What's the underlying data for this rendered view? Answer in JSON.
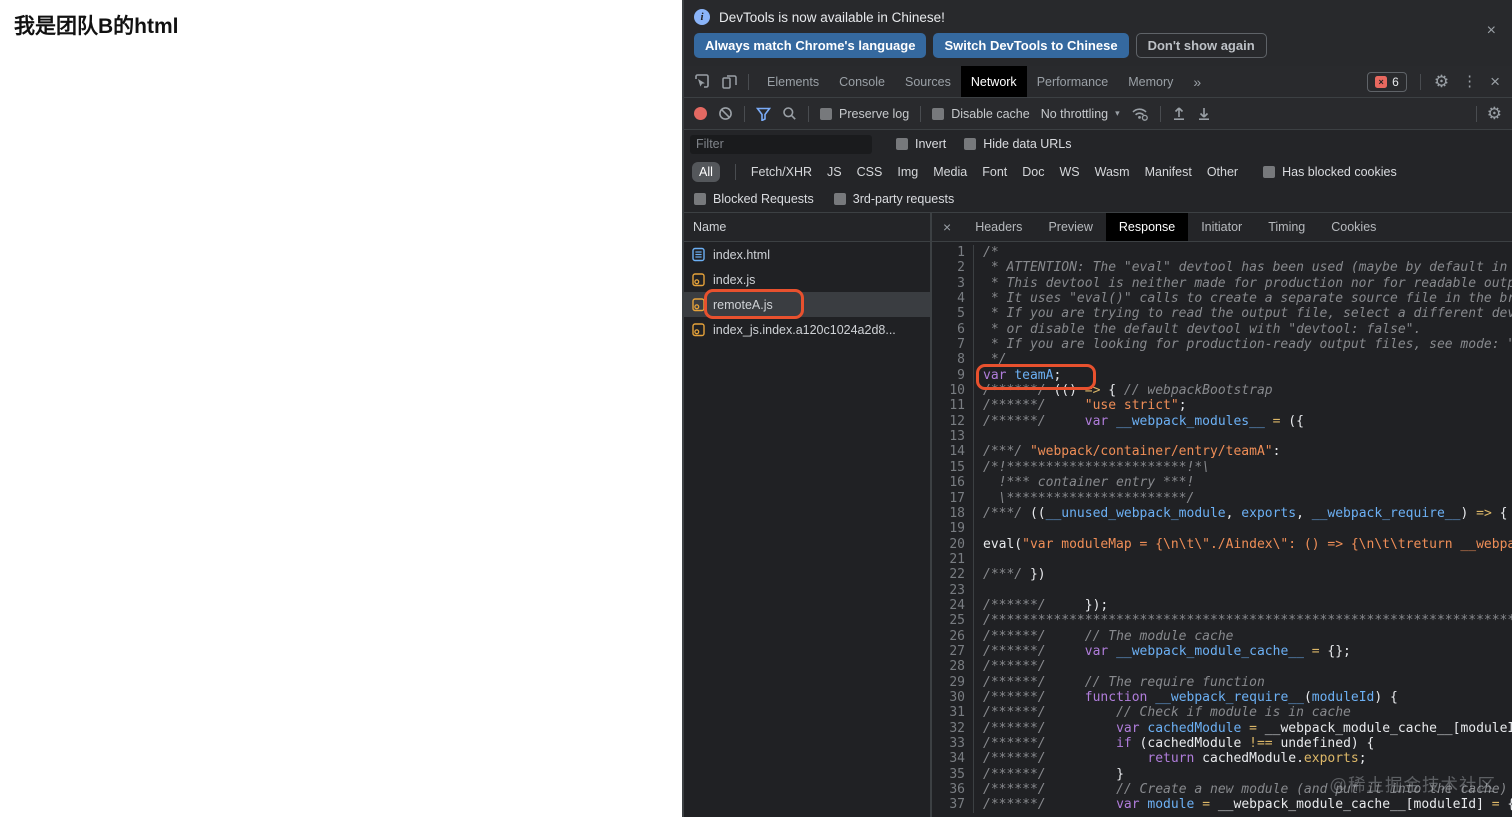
{
  "page": {
    "left_text": "我是团队B的html"
  },
  "infobar": {
    "message": "DevTools is now available in Chinese!",
    "buttons": [
      "Always match Chrome's language",
      "Switch DevTools to Chinese",
      "Don't show again"
    ],
    "close": "×"
  },
  "tabs": {
    "items": [
      "Elements",
      "Console",
      "Sources",
      "Network",
      "Performance",
      "Memory"
    ],
    "active": "Network",
    "overflow": "»",
    "error_count": "6",
    "error_x": "×",
    "gear": "⚙",
    "dots": "⋮",
    "close": "×"
  },
  "toolbar": {
    "preserve_log": "Preserve log",
    "disable_cache": "Disable cache",
    "throttling": "No throttling",
    "caret": "▾",
    "gear": "⚙"
  },
  "filterbar": {
    "placeholder": "Filter",
    "invert": "Invert",
    "hide_data_urls": "Hide data URLs"
  },
  "chips": {
    "items": [
      "All",
      "Fetch/XHR",
      "JS",
      "CSS",
      "Img",
      "Media",
      "Font",
      "Doc",
      "WS",
      "Wasm",
      "Manifest",
      "Other"
    ],
    "active": "All",
    "has_blocked_cookies": "Has blocked cookies"
  },
  "blockedrow": {
    "blocked_requests": "Blocked Requests",
    "third_party": "3rd-party requests"
  },
  "requests": {
    "header": "Name",
    "items": [
      {
        "name": "index.html",
        "icon": "doc",
        "selected": false,
        "annotated": false
      },
      {
        "name": "index.js",
        "icon": "js",
        "selected": false,
        "annotated": false
      },
      {
        "name": "remoteA.js",
        "icon": "js",
        "selected": true,
        "annotated": true
      },
      {
        "name": "index_js.index.a120c1024a2d8...",
        "icon": "js",
        "selected": false,
        "annotated": false
      }
    ]
  },
  "detail_tabs": {
    "close": "×",
    "items": [
      "Headers",
      "Preview",
      "Response",
      "Initiator",
      "Timing",
      "Cookies"
    ],
    "active": "Response"
  },
  "watermark": "@稀土掘金技术社区",
  "colors": {
    "annotation": "#e8512e",
    "accent_blue": "#8ab4f8",
    "record_red": "#e46962",
    "active_tab_bg": "#000000"
  },
  "code": {
    "lines": [
      {
        "seg": [
          [
            "c",
            "/*"
          ]
        ]
      },
      {
        "seg": [
          [
            "c",
            " * ATTENTION: The \"eval\" devtool has been used (maybe by default in mode: \"development\")."
          ]
        ]
      },
      {
        "seg": [
          [
            "c",
            " * This devtool is neither made for production nor for readable output files."
          ]
        ]
      },
      {
        "seg": [
          [
            "c",
            " * It uses \"eval()\" calls to create a separate source file in the browser devtools."
          ]
        ]
      },
      {
        "seg": [
          [
            "c",
            " * If you are trying to read the output file, select a different devtool (https://webpack.js.org/configuration/devtool/)"
          ]
        ]
      },
      {
        "seg": [
          [
            "c",
            " * or disable the default devtool with \"devtool: false\"."
          ]
        ]
      },
      {
        "seg": [
          [
            "c",
            " * If you are looking for production-ready output files, see mode: \"production\" (https://webpack.js.org/configuration/mode/)."
          ]
        ]
      },
      {
        "seg": [
          [
            "c",
            " */"
          ]
        ]
      },
      {
        "seg": [
          [
            "k",
            "var"
          ],
          [
            "p",
            " "
          ],
          [
            "v",
            "teamA"
          ],
          [
            "p",
            ";"
          ]
        ]
      },
      {
        "seg": [
          [
            "c",
            "/******/"
          ],
          [
            "p",
            " (() "
          ],
          [
            "o",
            "=>"
          ],
          [
            "p",
            " { "
          ],
          [
            "c",
            "// webpackBootstrap"
          ]
        ]
      },
      {
        "seg": [
          [
            "c",
            "/******/"
          ],
          [
            "p",
            "     "
          ],
          [
            "s",
            "\"use strict\""
          ],
          [
            "p",
            ";"
          ]
        ]
      },
      {
        "seg": [
          [
            "c",
            "/******/"
          ],
          [
            "p",
            "     "
          ],
          [
            "k",
            "var"
          ],
          [
            "p",
            " "
          ],
          [
            "v",
            "__webpack_modules__"
          ],
          [
            "p",
            " "
          ],
          [
            "o",
            "="
          ],
          [
            "p",
            " ({"
          ]
        ]
      },
      {
        "seg": []
      },
      {
        "seg": [
          [
            "c",
            "/***/"
          ],
          [
            "p",
            " "
          ],
          [
            "s",
            "\"webpack/container/entry/teamA\""
          ],
          [
            "p",
            ":"
          ]
        ]
      },
      {
        "seg": [
          [
            "c",
            "/*!***********************!*\\"
          ]
        ]
      },
      {
        "seg": [
          [
            "c",
            "  !*** container entry ***!"
          ]
        ]
      },
      {
        "seg": [
          [
            "c",
            "  \\***********************/"
          ]
        ]
      },
      {
        "seg": [
          [
            "c",
            "/***/"
          ],
          [
            "p",
            " (("
          ],
          [
            "v",
            "__unused_webpack_module"
          ],
          [
            "p",
            ", "
          ],
          [
            "v",
            "exports"
          ],
          [
            "p",
            ", "
          ],
          [
            "v",
            "__webpack_require__"
          ],
          [
            "p",
            ") "
          ],
          [
            "o",
            "=>"
          ],
          [
            "p",
            " {"
          ]
        ]
      },
      {
        "seg": []
      },
      {
        "seg": [
          [
            "p",
            "eval("
          ],
          [
            "s",
            "\"var moduleMap = {\\n\\t\\\"./Aindex\\\": () => {\\n\\t\\treturn __webpack_require__.e"
          ]
        ]
      },
      {
        "seg": []
      },
      {
        "seg": [
          [
            "c",
            "/***/"
          ],
          [
            "p",
            " })"
          ]
        ]
      },
      {
        "seg": []
      },
      {
        "seg": [
          [
            "c",
            "/******/"
          ],
          [
            "p",
            "     });"
          ]
        ]
      },
      {
        "seg": [
          [
            "c",
            "/**********************************************************************************************************/"
          ]
        ]
      },
      {
        "seg": [
          [
            "c",
            "/******/"
          ],
          [
            "p",
            "     "
          ],
          [
            "c",
            "// The module cache"
          ]
        ]
      },
      {
        "seg": [
          [
            "c",
            "/******/"
          ],
          [
            "p",
            "     "
          ],
          [
            "k",
            "var"
          ],
          [
            "p",
            " "
          ],
          [
            "v",
            "__webpack_module_cache__"
          ],
          [
            "p",
            " "
          ],
          [
            "o",
            "="
          ],
          [
            "p",
            " {};"
          ]
        ]
      },
      {
        "seg": [
          [
            "c",
            "/******/"
          ]
        ]
      },
      {
        "seg": [
          [
            "c",
            "/******/"
          ],
          [
            "p",
            "     "
          ],
          [
            "c",
            "// The require function"
          ]
        ]
      },
      {
        "seg": [
          [
            "c",
            "/******/"
          ],
          [
            "p",
            "     "
          ],
          [
            "k",
            "function"
          ],
          [
            "p",
            " "
          ],
          [
            "v",
            "__webpack_require__"
          ],
          [
            "p",
            "("
          ],
          [
            "v",
            "moduleId"
          ],
          [
            "p",
            ") {"
          ]
        ]
      },
      {
        "seg": [
          [
            "c",
            "/******/"
          ],
          [
            "p",
            "         "
          ],
          [
            "c",
            "// Check if module is in cache"
          ]
        ]
      },
      {
        "seg": [
          [
            "c",
            "/******/"
          ],
          [
            "p",
            "         "
          ],
          [
            "k",
            "var"
          ],
          [
            "p",
            " "
          ],
          [
            "v",
            "cachedModule"
          ],
          [
            "p",
            " "
          ],
          [
            "o",
            "="
          ],
          [
            "p",
            " __webpack_module_cache__[moduleId];"
          ]
        ]
      },
      {
        "seg": [
          [
            "c",
            "/******/"
          ],
          [
            "p",
            "         "
          ],
          [
            "k",
            "if"
          ],
          [
            "p",
            " (cachedModule "
          ],
          [
            "o",
            "!=="
          ],
          [
            "p",
            " undefined) {"
          ]
        ]
      },
      {
        "seg": [
          [
            "c",
            "/******/"
          ],
          [
            "p",
            "             "
          ],
          [
            "k",
            "return"
          ],
          [
            "p",
            " cachedModule."
          ],
          [
            "o",
            "exports"
          ],
          [
            "p",
            ";"
          ]
        ]
      },
      {
        "seg": [
          [
            "c",
            "/******/"
          ],
          [
            "p",
            "         }"
          ]
        ]
      },
      {
        "seg": [
          [
            "c",
            "/******/"
          ],
          [
            "p",
            "         "
          ],
          [
            "c",
            "// Create a new module (and put it into the cache)"
          ]
        ]
      },
      {
        "seg": [
          [
            "c",
            "/******/"
          ],
          [
            "p",
            "         "
          ],
          [
            "k",
            "var"
          ],
          [
            "p",
            " "
          ],
          [
            "v",
            "module"
          ],
          [
            "p",
            " "
          ],
          [
            "o",
            "="
          ],
          [
            "p",
            " __webpack_module_cache__[moduleId] "
          ],
          [
            "o",
            "="
          ],
          [
            "p",
            " {"
          ]
        ]
      }
    ]
  }
}
